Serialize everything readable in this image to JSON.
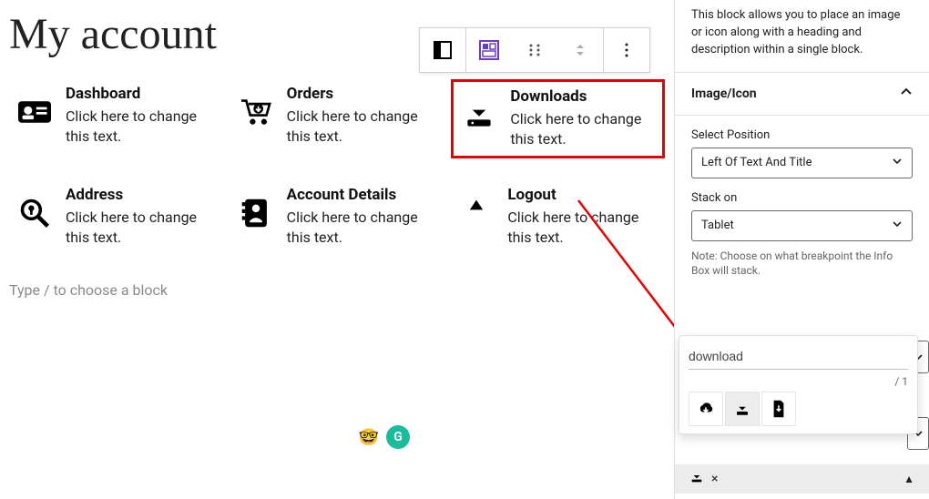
{
  "page": {
    "title": "My account",
    "type_prompt": "Type / to choose a block"
  },
  "info_boxes": [
    {
      "title": "Dashboard",
      "desc": "Click here to change this text."
    },
    {
      "title": "Orders",
      "desc": "Click here to change this text."
    },
    {
      "title": "Downloads",
      "desc": "Click here to change this text."
    },
    {
      "title": "Address",
      "desc": "Click here to change this text."
    },
    {
      "title": "Account Details",
      "desc": "Click here to change this text."
    },
    {
      "title": "Logout",
      "desc": "Click here to change this text."
    }
  ],
  "sidebar": {
    "block_desc": "This block allows you to place an image or icon along with a heading and description within a single block.",
    "panel_title": "Image/Icon",
    "select_position": {
      "label": "Select Position",
      "value": "Left Of Text And Title"
    },
    "stack_on": {
      "label": "Stack on",
      "value": "Tablet",
      "note": "Note: Choose on what breakpoint the Info Box will stack."
    }
  },
  "icon_picker": {
    "search_value": "download",
    "page_info": "/  1"
  }
}
